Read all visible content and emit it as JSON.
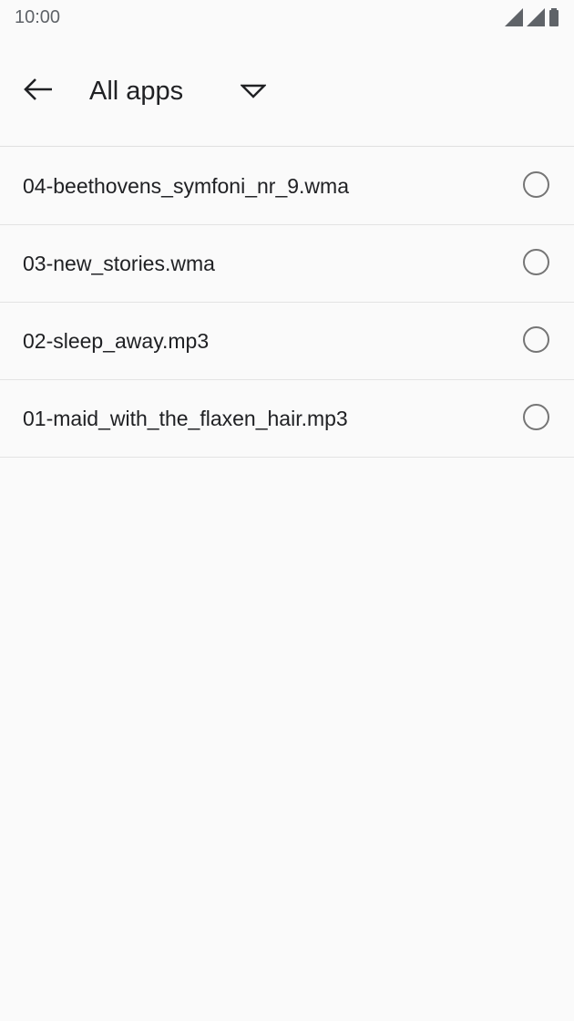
{
  "status_bar": {
    "time": "10:00",
    "icons": [
      "signal-icon",
      "signal-icon",
      "battery-icon"
    ]
  },
  "app_bar": {
    "back_icon": "arrow-left-icon",
    "title": "All apps",
    "dropdown_icon": "triangle-down-icon"
  },
  "files": [
    {
      "name": "04-beethovens_symfoni_nr_9.wma",
      "selected": false
    },
    {
      "name": "03-new_stories.wma",
      "selected": false
    },
    {
      "name": "02-sleep_away.mp3",
      "selected": false
    },
    {
      "name": "01-maid_with_the_flaxen_hair.mp3",
      "selected": false
    }
  ],
  "colors": {
    "background": "#fafafa",
    "text": "#202124",
    "divider": "#e3e3e3",
    "radio_outline": "#757575"
  }
}
